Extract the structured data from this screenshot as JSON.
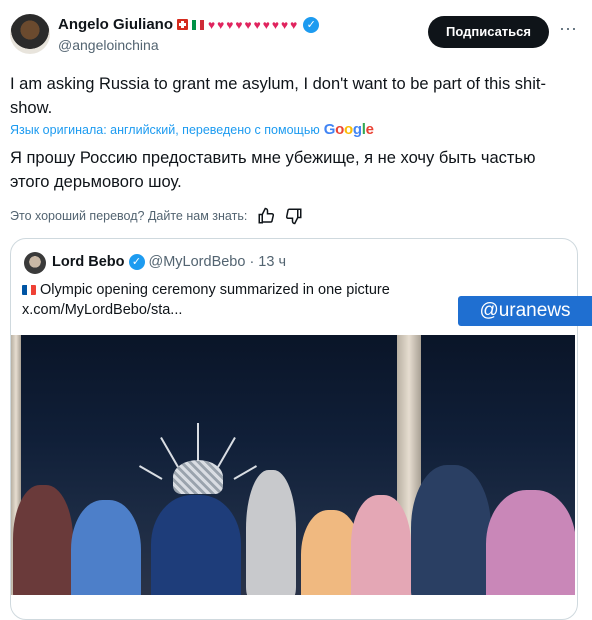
{
  "tweet": {
    "author_name": "Angelo Giuliano",
    "author_handle": "@angeloinchina",
    "name_decorations": "♥♥♥♥♥♥♥♥♥♥",
    "subscribe_label": "Подписаться",
    "more_glyph": "···",
    "text": "I am asking Russia to grant me asylum, I don't want to be part of this shit-show.",
    "translation_note": "Язык оригинала: английский, переведено с помощью",
    "google_label": "Google",
    "translated_text": "Я прошу Россию предоставить мне убежище, я не хочу быть частью этого дерьмового шоу.",
    "rate_question": "Это хороший перевод? Дайте нам знать:"
  },
  "quote": {
    "author_name": "Lord Bebo",
    "author_handle": "@MyLordBebo",
    "time": "13 ч",
    "separator": "·",
    "text": "Olympic opening ceremony summarized in one picture",
    "link": "x.com/MyLordBebo/sta..."
  },
  "watermark": "@uranews",
  "colors": {
    "accent": "#1d9bf0",
    "heart": "#e0245e",
    "watermark_bg": "#1f6fd1",
    "button_bg": "#0f1419"
  }
}
